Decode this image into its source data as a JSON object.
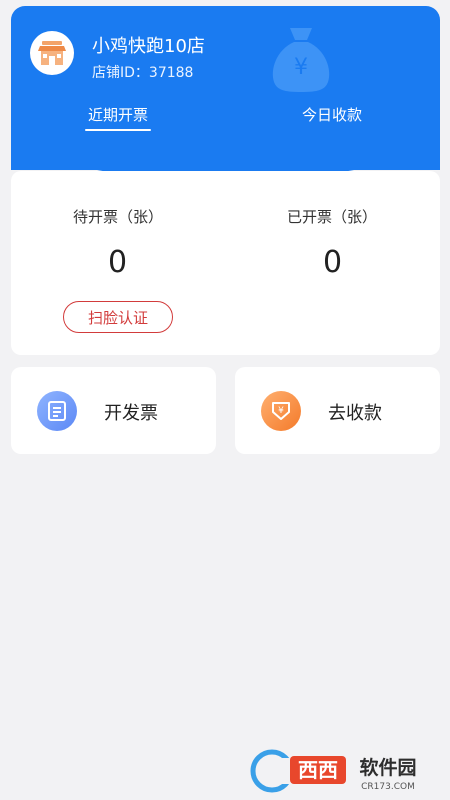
{
  "header": {
    "store_name": "小鸡快跑10店",
    "store_id": "店铺ID：37188",
    "tabs": [
      {
        "label": "近期开票",
        "active": true
      },
      {
        "label": "今日收款",
        "active": false
      }
    ]
  },
  "stats": {
    "pending_label": "待开票（张）",
    "pending_value": "0",
    "issued_label": "已开票（张）",
    "issued_value": "0",
    "face_auth_label": "扫脸认证"
  },
  "actions": [
    {
      "label": "开发票",
      "icon": "invoice-icon"
    },
    {
      "label": "去收款",
      "icon": "collect-money-icon"
    }
  ],
  "watermark": {
    "text": "西西软件园",
    "subtext": "CR173.COM"
  },
  "colors": {
    "brand_blue": "#1a7bf1",
    "accent_red": "#d23b3b",
    "invoice_icon": "#5c88f5",
    "collect_icon": "#f47a2a"
  }
}
